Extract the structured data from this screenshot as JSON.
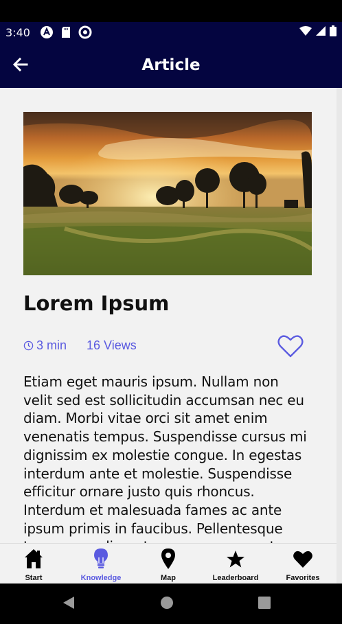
{
  "status_bar": {
    "time": "3:40",
    "icons": [
      "notification-a-icon",
      "sd-card-icon",
      "data-saver-icon"
    ],
    "right_icons": [
      "wifi-icon",
      "signal-icon",
      "battery-icon"
    ]
  },
  "app_bar": {
    "title": "Article",
    "back_icon": "arrow-left-icon"
  },
  "article": {
    "image_icon": "landscape-sunset-photo",
    "title": "Lorem Ipsum",
    "read_time": "3 min",
    "views": "16 Views",
    "body": "Etiam eget mauris ipsum. Nullam non velit sed est sollicitudin accumsan nec eu diam. Morbi vitae orci sit amet enim venenatis tempus. Suspendisse cursus mi dignissim ex molestie congue. In egestas interdum ante et molestie. Suspendisse efficitur ornare justo quis rhoncus. Interdum et malesuada fames ac ante ipsum primis in faucibus. Pellentesque tempor condimentum neque, ac auctor"
  },
  "bottom_nav": {
    "items": [
      {
        "label": "Start",
        "icon": "home-icon"
      },
      {
        "label": "Knowledge",
        "icon": "lightbulb-icon"
      },
      {
        "label": "Map",
        "icon": "map-pin-icon"
      },
      {
        "label": "Leaderboard",
        "icon": "star-icon"
      },
      {
        "label": "Favorites",
        "icon": "heart-icon"
      }
    ],
    "active_index": 1
  },
  "colors": {
    "app_bar": "#040540",
    "accent": "#5b5be0",
    "background": "#f2f2f2"
  }
}
